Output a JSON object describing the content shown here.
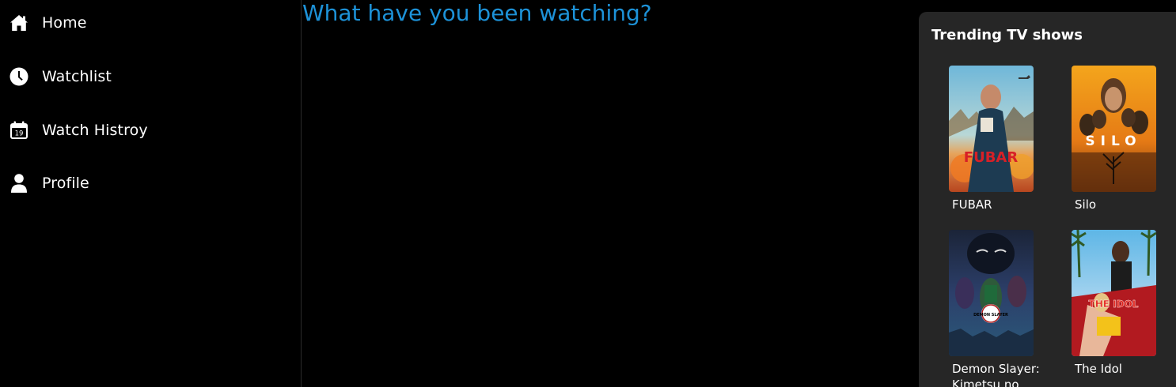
{
  "sidebar": {
    "items": [
      {
        "label": "Home",
        "icon": "home-icon"
      },
      {
        "label": "Watchlist",
        "icon": "clock-icon"
      },
      {
        "label": "Watch Histroy",
        "icon": "calendar-icon",
        "icon_text": "19"
      },
      {
        "label": "Profile",
        "icon": "user-icon"
      }
    ]
  },
  "main": {
    "prompt": "What have you been watching?"
  },
  "trending": {
    "title": "Trending TV shows",
    "shows": [
      {
        "title": "FUBAR",
        "poster_text": "FUBAR"
      },
      {
        "title": "Silo",
        "poster_text": "SILO"
      },
      {
        "title": "Demon Slayer: Kimetsu no",
        "poster_text": "DEMON SLAYER"
      },
      {
        "title": "The Idol",
        "poster_text": "THE IDOL"
      }
    ]
  },
  "colors": {
    "background": "#000000",
    "accent": "#1d92d8",
    "panel": "#262626",
    "text": "#ffffff"
  }
}
